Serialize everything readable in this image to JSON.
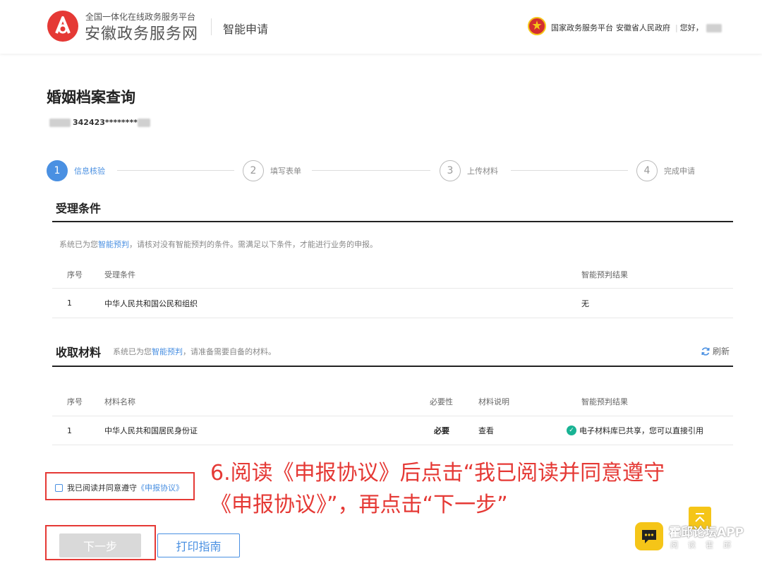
{
  "header": {
    "logo_subtitle": "全国一体化在线政务服务平台",
    "logo_title": "安徽政务服务网",
    "service_name": "智能申请",
    "links": [
      "国家政务服务平台",
      "安徽省人民政府",
      "您好，"
    ]
  },
  "page": {
    "title": "婚姻档案查询",
    "id_number": "342423********"
  },
  "steps": [
    {
      "num": "1",
      "label": "信息核验",
      "active": true
    },
    {
      "num": "2",
      "label": "填写表单",
      "active": false
    },
    {
      "num": "3",
      "label": "上传材料",
      "active": false
    },
    {
      "num": "4",
      "label": "完成申请",
      "active": false
    }
  ],
  "conditions": {
    "title": "受理条件",
    "hint_prefix": "系统已为您",
    "hint_link": "智能预判",
    "hint_suffix": "，请核对没有智能预判的条件。需满足以下条件，才能进行业务的申报。",
    "columns": [
      "序号",
      "受理条件",
      "智能预判结果"
    ],
    "rows": [
      {
        "no": "1",
        "condition": "中华人民共和国公民和组织",
        "result": "无"
      }
    ]
  },
  "materials": {
    "title": "收取材料",
    "hint_prefix": "系统已为您",
    "hint_link": "智能预判",
    "hint_suffix": "，请准备需要自备的材料。",
    "refresh_label": "刷新",
    "columns": [
      "序号",
      "材料名称",
      "必要性",
      "材料说明",
      "智能预判结果"
    ],
    "rows": [
      {
        "no": "1",
        "name": "中华人民共和国居民身份证",
        "necessity": "必要",
        "desc_link": "查看",
        "result": "电子材料库已共享，您可以直接引用"
      }
    ]
  },
  "agreement": {
    "prefix": "我已阅读并同意遵守",
    "link": "《申报协议》"
  },
  "annotation": {
    "line1": "6.阅读《申报协议》后点击“我已阅读并同意遵守",
    "line2": "《申报协议》”，再点击“下一步”"
  },
  "buttons": {
    "next": "下一步",
    "print": "打印指南"
  },
  "watermark": {
    "title": "霍邱论坛APP",
    "subtitle": "阅读霍邱"
  },
  "colors": {
    "accent": "#4a90e2",
    "annotation_red": "#e53935",
    "success": "#19b394",
    "watermark_yellow": "#f5c518"
  }
}
